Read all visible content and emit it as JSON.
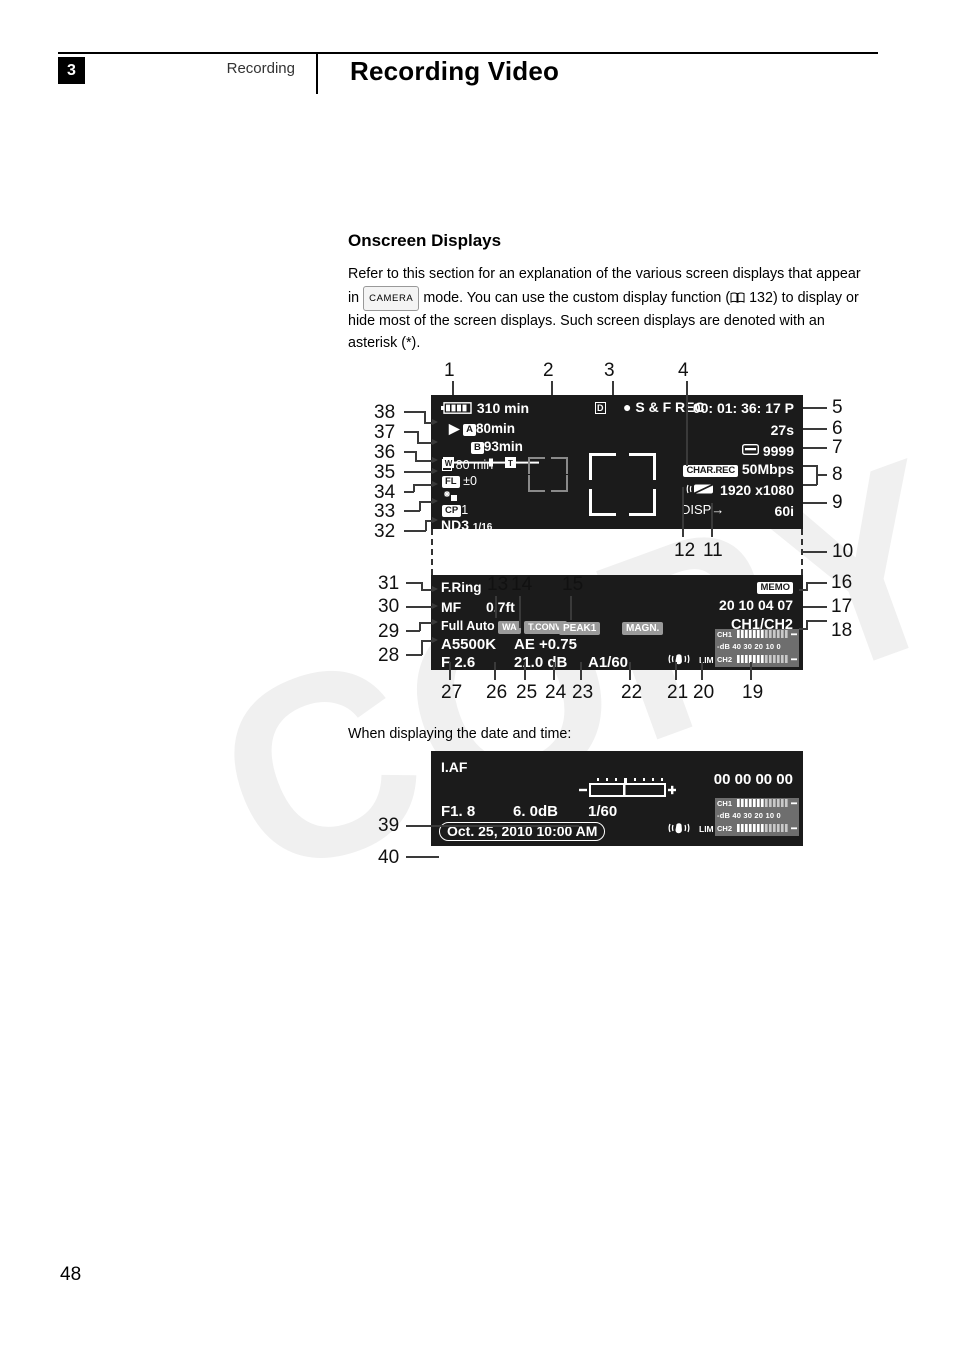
{
  "header": {
    "chapter_number": "3",
    "chapter_name": "Recording",
    "page_title": "Recording Video"
  },
  "section": {
    "title": "Onscreen Displays",
    "intro_part1": "Refer to this section for an explanation of the various screen displays that appear in ",
    "camera_badge": "CAMERA",
    "intro_part2": " mode. You can use the custom display function (",
    "page_ref": "132",
    "intro_part3": ") to display or hide most of the screen displays. Such screen displays are denoted with an asterisk (*).",
    "when_text": "When displaying the date and time:"
  },
  "footer": {
    "page_number": "48"
  },
  "screen1": {
    "battery_time": "310 min",
    "card_icon": "D",
    "rec_status": "S & F REC",
    "timecode": "00: 01: 36: 17 P",
    "interval": "27s",
    "photo_count": "9999",
    "slot_a": "80min",
    "slot_a_label": "A",
    "slot_b": "93min",
    "slot_b_label": "B",
    "slot_d_label": "D",
    "slot_d": "80 min",
    "char_rec": "CHAR.REC",
    "bitrate": "50Mbps",
    "resolution": "1920 x1080",
    "framerate": "60i",
    "disp_label": "DISP",
    "rec_label": "REC",
    "zoom_w": "W",
    "zoom_t": "T",
    "flash_label": "FL",
    "flash_value": "±0",
    "cp_label": "CP",
    "cp_value": "1",
    "nd_label": "ND3",
    "nd_value": "1/16",
    "focus_ring": "F.Ring",
    "focus_mode": "MF",
    "focus_distance": "0.7ft",
    "exposure_mode": "Full Auto",
    "wa_badge": "WA",
    "tconv_badge": "T.CONV.",
    "peak_badge": "PEAK1",
    "magn_badge": "MAGN.",
    "memo_badge": "MEMO",
    "user_bits": "20 10  04  07",
    "audio_ch": "CH1/CH2",
    "white_balance": "A5500K",
    "ae_shift": "AE +0.75",
    "aperture": "F 2.6",
    "gain": "21.0 dB",
    "shutter": "A1/60",
    "lim_label": "LIM",
    "meter_ch1": "CH1",
    "meter_ch2": "CH2",
    "meter_scale": "-dB 40 30  20      10      0"
  },
  "screen2": {
    "af_mode": "I.AF",
    "timecode": "00 00  00  00",
    "aperture": "F1. 8",
    "gain": "6. 0dB",
    "shutter": "1/60",
    "datetime": "Oct. 25, 2010 10:00 AM",
    "lim_label": "LIM",
    "meter_ch1": "CH1",
    "meter_ch2": "CH2",
    "meter_scale": "-dB 40 30  20      10      0"
  },
  "callouts": {
    "top": [
      "1",
      "2",
      "3",
      "4"
    ],
    "right_upper": [
      "5",
      "6",
      "7",
      "8",
      "9",
      "10"
    ],
    "mid": [
      "12",
      "11"
    ],
    "mid_left": [
      "13",
      "14",
      "15"
    ],
    "right_lower": [
      "16",
      "17",
      "18"
    ],
    "bottom": [
      "27",
      "26",
      "25",
      "24",
      "23",
      "22",
      "21",
      "20",
      "19"
    ],
    "left_upper": [
      "38",
      "37",
      "36",
      "35",
      "34",
      "33",
      "32"
    ],
    "left_lower": [
      "31",
      "30",
      "29",
      "28"
    ],
    "screen2_left": [
      "39",
      "40"
    ]
  },
  "watermark": "COPY"
}
